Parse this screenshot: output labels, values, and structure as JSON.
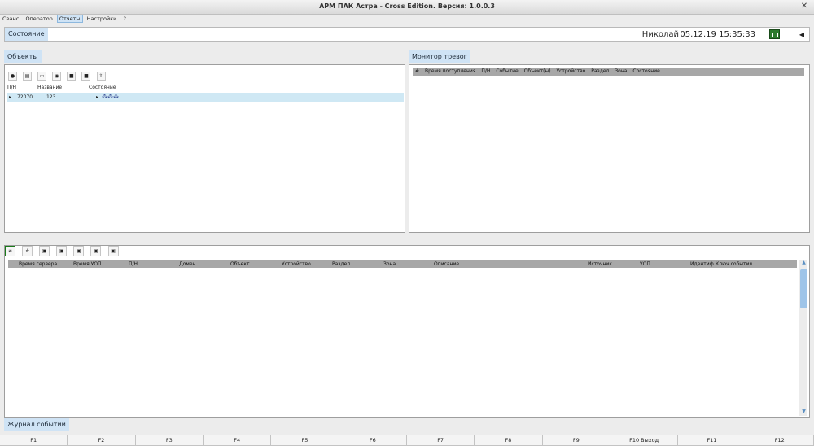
{
  "window": {
    "title": "АРМ ПАК Астра - Cross Edition. Версия: 1.0.0.3"
  },
  "menu": {
    "items": [
      "Сеанс",
      "Оператор",
      "Отчеты",
      "Настройки",
      "?"
    ]
  },
  "status": {
    "label": "Состояние",
    "user": "Николай",
    "datetime": "05.12.19 15:35:33"
  },
  "objects": {
    "label": "Объекты",
    "columns": [
      "П/Н",
      "Название",
      "Состояние"
    ],
    "rows": [
      {
        "pn": "72070",
        "name": "123"
      }
    ]
  },
  "alarm": {
    "label": "Монитор тревог",
    "columns": [
      "#",
      "Время поступления",
      "П/Н",
      "Событие",
      "Объект(ы)",
      "Устройство",
      "Раздел",
      "Зона",
      "Состояние"
    ]
  },
  "journal": {
    "label": "Журнал событий",
    "columns": [
      "Время сервера",
      "Время УОП",
      "П/Н",
      "Домен",
      "Объект",
      "Устройство",
      "Раздел",
      "Зона",
      "Описание",
      "Источник",
      "УОП",
      "Идентиф",
      "Ключ события"
    ]
  },
  "fkeys": [
    "F1",
    "F2",
    "F3",
    "F4",
    "F5",
    "F6",
    "F7",
    "F8",
    "F9",
    "F10 Выход",
    "F11",
    "F12"
  ]
}
